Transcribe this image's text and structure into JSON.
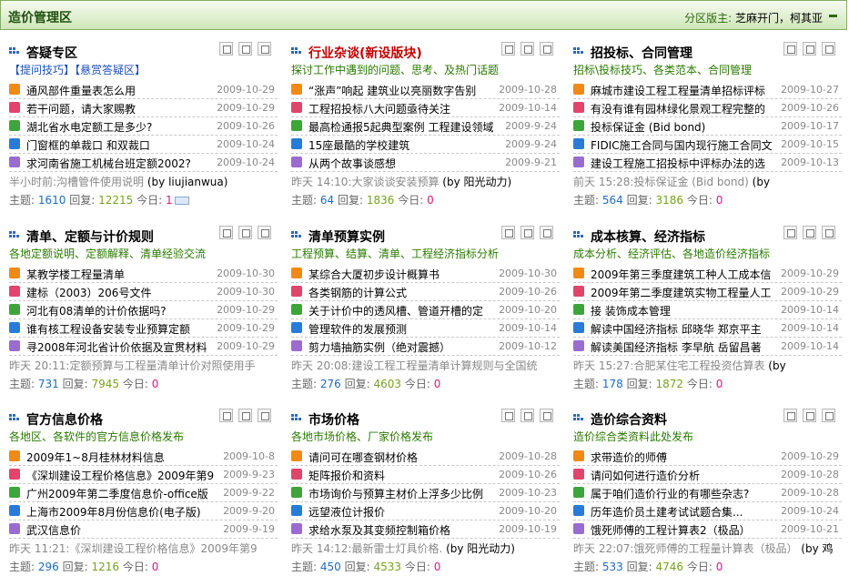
{
  "header": {
    "title": "造价管理区",
    "moderators_label": "分区版主:",
    "moderators": "芝麻开门，柯其亚"
  },
  "forums": [
    {
      "name": "答疑专区",
      "name_color": "black",
      "desc": "【提问技巧】【悬赏答疑区】",
      "desc_color": "blue",
      "threads": [
        {
          "title": "通风部件重量表怎么用",
          "date": "2009-10-29",
          "icon": "orange"
        },
        {
          "title": "若干问题，请大家赐教",
          "date": "2009-10-29",
          "icon": "red"
        },
        {
          "title": "湖北省水电定额工是多少?",
          "date": "2009-10-26",
          "icon": "green"
        },
        {
          "title": "门窗框的单裁口 和双裁口",
          "date": "2009-10-24",
          "icon": "blue"
        },
        {
          "title": "求河南省施工机械台班定额2002?",
          "date": "2009-10-24",
          "icon": "purple"
        }
      ],
      "last_post": "半小时前:沟槽管件使用说明",
      "last_by": "(by liujianwua)",
      "stats": {
        "topics_label": "主题:",
        "topics": "1610",
        "replies_label": "回复:",
        "replies": "12215",
        "today_label": "今日:",
        "today": "1"
      }
    },
    {
      "name": "行业杂谈(新设版块)",
      "name_color": "red",
      "desc": "探讨工作中遇到的问题、思考、及热门话题",
      "desc_color": "green",
      "threads": [
        {
          "title": "“涨声”响起 建筑业以亮丽数字告别",
          "date": "2009-10-28",
          "icon": "orange"
        },
        {
          "title": "工程招投标八大问题亟待关注",
          "date": "2009-10-14",
          "icon": "red"
        },
        {
          "title": "最高检通报5起典型案例 工程建设领域",
          "date": "2009-9-24",
          "icon": "green"
        },
        {
          "title": "15座最酷的学校建筑",
          "date": "2009-9-24",
          "icon": "blue"
        },
        {
          "title": "从两个故事谈感想",
          "date": "2009-9-21",
          "icon": "purple"
        }
      ],
      "last_post": "昨天 14:10:大家谈谈安装预算",
      "last_by": "(by 阳光动力)",
      "stats": {
        "topics_label": "主题:",
        "topics": "64",
        "replies_label": "回复:",
        "replies": "1836",
        "today_label": "今日:",
        "today": "0"
      }
    },
    {
      "name": "招投标、合同管理",
      "name_color": "black",
      "desc": "招标\\投标技巧、各类范本、合同管理",
      "desc_color": "green",
      "threads": [
        {
          "title": "麻城市建设工程工程量清单招标评标",
          "date": "2009-10-27",
          "icon": "orange"
        },
        {
          "title": "有没有谁有园林绿化景观工程完整的",
          "date": "2009-10-26",
          "icon": "red"
        },
        {
          "title": "投标保证金 (Bid bond)",
          "date": "2009-10-17",
          "icon": "green"
        },
        {
          "title": "FIDIC施工合同与国内现行施工合同文",
          "date": "2009-10-15",
          "icon": "blue"
        },
        {
          "title": "建设工程施工招投标中评标办法的选",
          "date": "2009-10-13",
          "icon": "purple"
        }
      ],
      "last_post": "前天 15:28:投标保证金 (Bid bond)",
      "last_by": "(by",
      "stats": {
        "topics_label": "主题:",
        "topics": "564",
        "replies_label": "回复:",
        "replies": "3186",
        "today_label": "今日:",
        "today": "0"
      }
    },
    {
      "name": "清单、定额与计价规则",
      "name_color": "black",
      "desc": "各地定额说明、定额解释、清单经验交流",
      "desc_color": "green",
      "threads": [
        {
          "title": "某教学楼工程量清单",
          "date": "2009-10-30",
          "icon": "orange"
        },
        {
          "title": "建标（2003）206号文件",
          "date": "2009-10-30",
          "icon": "red"
        },
        {
          "title": "河北有08清单的计价依据吗?",
          "date": "2009-10-29",
          "icon": "green"
        },
        {
          "title": "谁有核工程设备安装专业预算定额",
          "date": "2009-10-29",
          "icon": "blue"
        },
        {
          "title": "寻2008年河北省计价依据及宣贯材料",
          "date": "2009-10-29",
          "icon": "purple"
        }
      ],
      "last_post": "昨天 20:11:定额预算与工程量清单计价对照使用手",
      "last_by": "",
      "stats": {
        "topics_label": "主题:",
        "topics": "731",
        "replies_label": "回复:",
        "replies": "7945",
        "today_label": "今日:",
        "today": "0"
      }
    },
    {
      "name": "清单预算实例",
      "name_color": "black",
      "desc": "工程预算、结算、清单、工程经济指标分析",
      "desc_color": "green",
      "threads": [
        {
          "title": "某综合大厦初步设计概算书",
          "date": "2009-10-30",
          "icon": "orange"
        },
        {
          "title": "各类钢筋的计算公式",
          "date": "2009-10-26",
          "icon": "red"
        },
        {
          "title": "关于计价中的透风槽、管道开槽的定",
          "date": "2009-10-20",
          "icon": "green"
        },
        {
          "title": "管理软件的发展预测",
          "date": "2009-10-14",
          "icon": "blue"
        },
        {
          "title": "剪力墙抽筋实例（绝对震撼）",
          "date": "2009-10-12",
          "icon": "purple"
        }
      ],
      "last_post": "昨天 20:08:建设工程工程量清单计算规则与全国统",
      "last_by": "",
      "stats": {
        "topics_label": "主题:",
        "topics": "276",
        "replies_label": "回复:",
        "replies": "4603",
        "today_label": "今日:",
        "today": "0"
      }
    },
    {
      "name": "成本核算、经济指标",
      "name_color": "black",
      "desc": "成本分析、经济评估、各地造价经济指标",
      "desc_color": "green",
      "threads": [
        {
          "title": "2009年第三季度建筑工种人工成本信",
          "date": "2009-10-29",
          "icon": "orange"
        },
        {
          "title": "2009年第二季度建筑实物工程量人工",
          "date": "2009-10-29",
          "icon": "red"
        },
        {
          "title": "接 装饰成本管理",
          "date": "2009-10-14",
          "icon": "green"
        },
        {
          "title": "解读中国经济指标 邱晓华 郑京平主",
          "date": "2009-10-14",
          "icon": "blue"
        },
        {
          "title": "解读美国经济指标 李早航 岳留昌著",
          "date": "2009-10-14",
          "icon": "purple"
        }
      ],
      "last_post": "昨天 15:27:合肥某住宅工程投资估算表",
      "last_by": "(by",
      "stats": {
        "topics_label": "主题:",
        "topics": "178",
        "replies_label": "回复:",
        "replies": "1872",
        "today_label": "今日:",
        "today": "0"
      }
    },
    {
      "name": "官方信息价格",
      "name_color": "black",
      "desc": "各地区、各软件的官方信息价格发布",
      "desc_color": "green",
      "threads": [
        {
          "title": "2009年1~8月桂林材料信息",
          "date": "2009-10-8",
          "icon": "orange"
        },
        {
          "title": "《深圳建设工程价格信息》2009年第9",
          "date": "2009-9-23",
          "icon": "red"
        },
        {
          "title": "广州2009年第二季度信息价-office版",
          "date": "2009-9-22",
          "icon": "green"
        },
        {
          "title": "上海市2009年8月份信息价(电子版)",
          "date": "2009-9-20",
          "icon": "blue"
        },
        {
          "title": "武汉信息价",
          "date": "2009-9-19",
          "icon": "purple"
        }
      ],
      "last_post": "昨天 11:21:《深圳建设工程价格信息》2009年第9",
      "last_by": "",
      "stats": {
        "topics_label": "主题:",
        "topics": "296",
        "replies_label": "回复:",
        "replies": "1216",
        "today_label": "今日:",
        "today": "0"
      }
    },
    {
      "name": "市场价格",
      "name_color": "black",
      "desc": "各地市场价格、厂家价格发布",
      "desc_color": "green",
      "threads": [
        {
          "title": "请问可在哪查钢材价格",
          "date": "2009-10-28",
          "icon": "orange"
        },
        {
          "title": "矩阵报价和资料",
          "date": "2009-10-26",
          "icon": "red"
        },
        {
          "title": "市场询价与预算主材价上浮多少比例",
          "date": "2009-10-23",
          "icon": "green"
        },
        {
          "title": "远望液位计报价",
          "date": "2009-10-20",
          "icon": "blue"
        },
        {
          "title": "求给水泵及其变频控制箱价格",
          "date": "2009-10-19",
          "icon": "purple"
        }
      ],
      "last_post": "昨天 14:12:最新雷士灯具价格.",
      "last_by": "(by 阳光动力)",
      "stats": {
        "topics_label": "主题:",
        "topics": "450",
        "replies_label": "回复:",
        "replies": "4533",
        "today_label": "今日:",
        "today": "0"
      }
    },
    {
      "name": "造价综合资料",
      "name_color": "black",
      "desc": "造价综合类资料此处发布",
      "desc_color": "green",
      "threads": [
        {
          "title": "求带造价的师傅",
          "date": "2009-10-29",
          "icon": "orange"
        },
        {
          "title": "请问如何进行造价分析",
          "date": "2009-10-28",
          "icon": "red"
        },
        {
          "title": "属于咱们造价行业的有哪些杂志?",
          "date": "2009-10-28",
          "icon": "green"
        },
        {
          "title": "历年造价员土建考试试题合集...",
          "date": "2009-10-24",
          "icon": "blue"
        },
        {
          "title": "饿死师傅的工程计算表2（极品）",
          "date": "2009-10-21",
          "icon": "purple"
        }
      ],
      "last_post": "昨天 22:07:饿死师傅的工程量计算表（极品）",
      "last_by": "(by 鸡",
      "stats": {
        "topics_label": "主题:",
        "topics": "533",
        "replies_label": "回复:",
        "replies": "4746",
        "today_label": "今日:",
        "today": "0"
      }
    }
  ],
  "colors": {
    "orange": "#f08a17",
    "red": "#e0456b",
    "green": "#3ea53a",
    "blue": "#2a7bd5",
    "purple": "#9a6ccf"
  }
}
